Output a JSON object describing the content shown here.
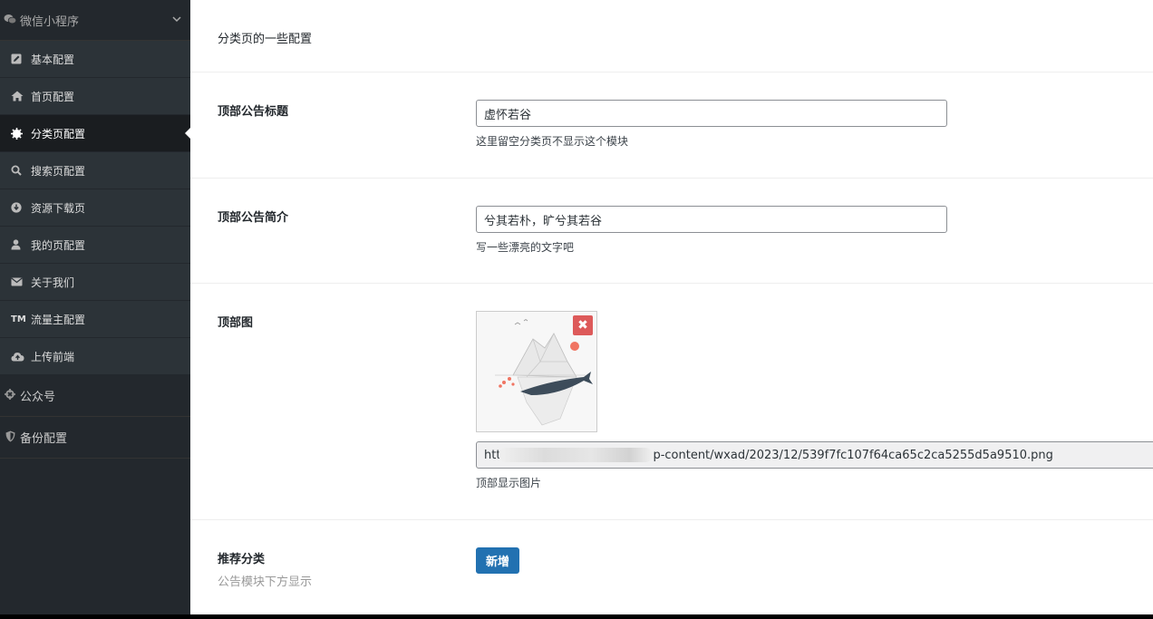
{
  "sidebar": {
    "group_title": "微信小程序",
    "items": [
      {
        "label": "基本配置",
        "icon": "edit-icon"
      },
      {
        "label": "首页配置",
        "icon": "home-icon"
      },
      {
        "label": "分类页配置",
        "icon": "gear-badge-icon",
        "active": true
      },
      {
        "label": "搜索页配置",
        "icon": "search-icon"
      },
      {
        "label": "资源下载页",
        "icon": "download-icon"
      },
      {
        "label": "我的页配置",
        "icon": "user-icon"
      },
      {
        "label": "关于我们",
        "icon": "envelope-icon"
      },
      {
        "label": "流量主配置",
        "icon": "tm-icon"
      },
      {
        "label": "上传前端",
        "icon": "cloud-upload-icon"
      }
    ],
    "top_items": [
      {
        "label": "公众号",
        "icon": "gear-icon"
      },
      {
        "label": "备份配置",
        "icon": "shield-icon"
      }
    ]
  },
  "main": {
    "section_desc": "分类页的一些配置",
    "fields": {
      "notice_title": {
        "label": "顶部公告标题",
        "value": "虚怀若谷",
        "help": "这里留空分类页不显示这个模块"
      },
      "notice_intro": {
        "label": "顶部公告简介",
        "value": "兮其若朴，旷兮其若谷",
        "help": "写一些漂亮的文字吧"
      },
      "top_image": {
        "label": "顶部图",
        "url_prefix": "htt",
        "url_suffix": "p-content/wxad/2023/12/539f7fc107f64ca65c2ca5255d5a9510.png",
        "help": "顶部显示图片",
        "delete_label": "✖"
      },
      "recommend": {
        "label": "推荐分类",
        "sub": "公告模块下方显示",
        "button": "新增"
      }
    }
  },
  "colors": {
    "sidebar_bg": "#23282d",
    "primary_button": "#2271b1",
    "delete_button": "#dd5a5a"
  }
}
